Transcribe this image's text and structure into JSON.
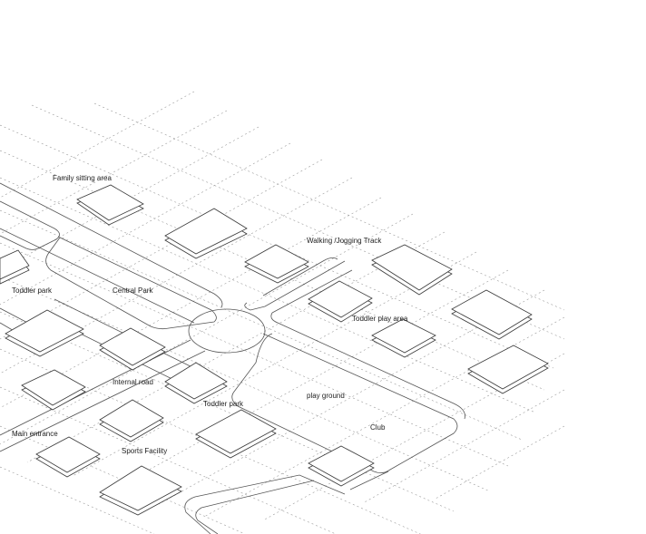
{
  "labels": {
    "family_sitting_area": "Family sitting area",
    "walking_jogging_track": "Walking /Jogging Track",
    "toddler_park_left": "Toddler park",
    "central_park": "Central Park",
    "toddler_play_area": "Toddler play area",
    "internal_road": "Internal road",
    "toddler_park_center": "Toddler park",
    "play_ground": "play ground",
    "main_entrance": "Main entrance",
    "club": "Club",
    "sports_facility": "Sports Facility"
  }
}
